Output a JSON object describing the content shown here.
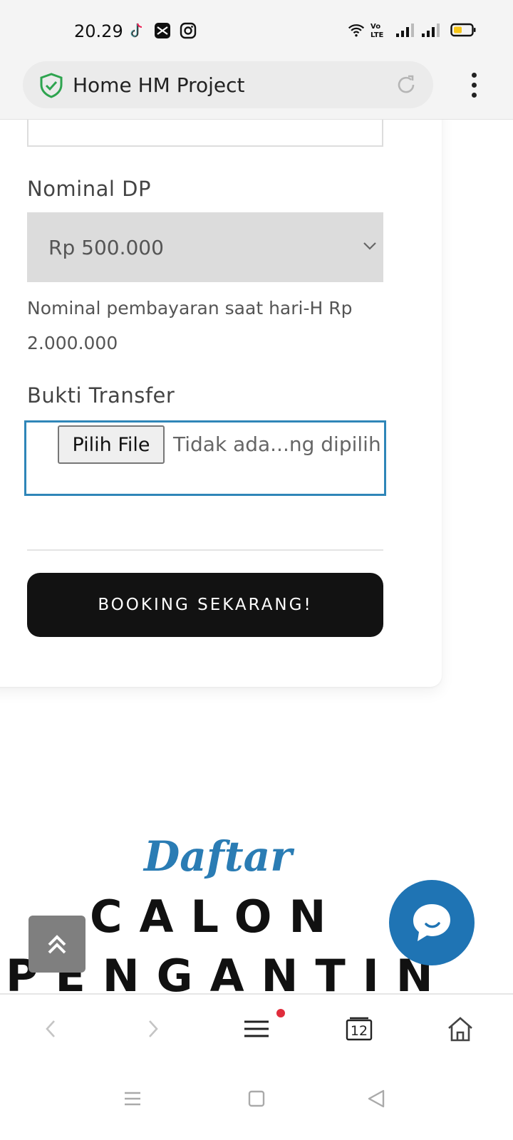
{
  "status_bar": {
    "time": "20.29",
    "left_icons": [
      "tiktok-icon",
      "capcut-icon",
      "instagram-icon"
    ],
    "right_icons": [
      "wifi-icon",
      "volte-icon",
      "signal-icon",
      "signal-icon",
      "battery-icon"
    ],
    "volte_label": "Vo LTE"
  },
  "browser": {
    "url_title": "Home HM Project",
    "tabs_count": "12"
  },
  "form": {
    "dp_label": "Nominal DP",
    "dp_selected": "Rp 500.000",
    "note": "Nominal pembayaran saat hari-H Rp 2.000.000",
    "proof_label": "Bukti Transfer",
    "file_button": "Pilih File",
    "file_status": "Tidak ada...ng dipilih",
    "submit_label": "BOOKING SEKARANG!"
  },
  "section": {
    "script_title": "Daftar",
    "heading_line1": "CALON",
    "heading_line2": "PENGANTIN"
  },
  "colors": {
    "accent": "#2a7cb4",
    "chat_fab": "#1f74b4",
    "button_dark": "#121212",
    "file_border": "#2f86b8",
    "notification_dot": "#e02d3c"
  }
}
